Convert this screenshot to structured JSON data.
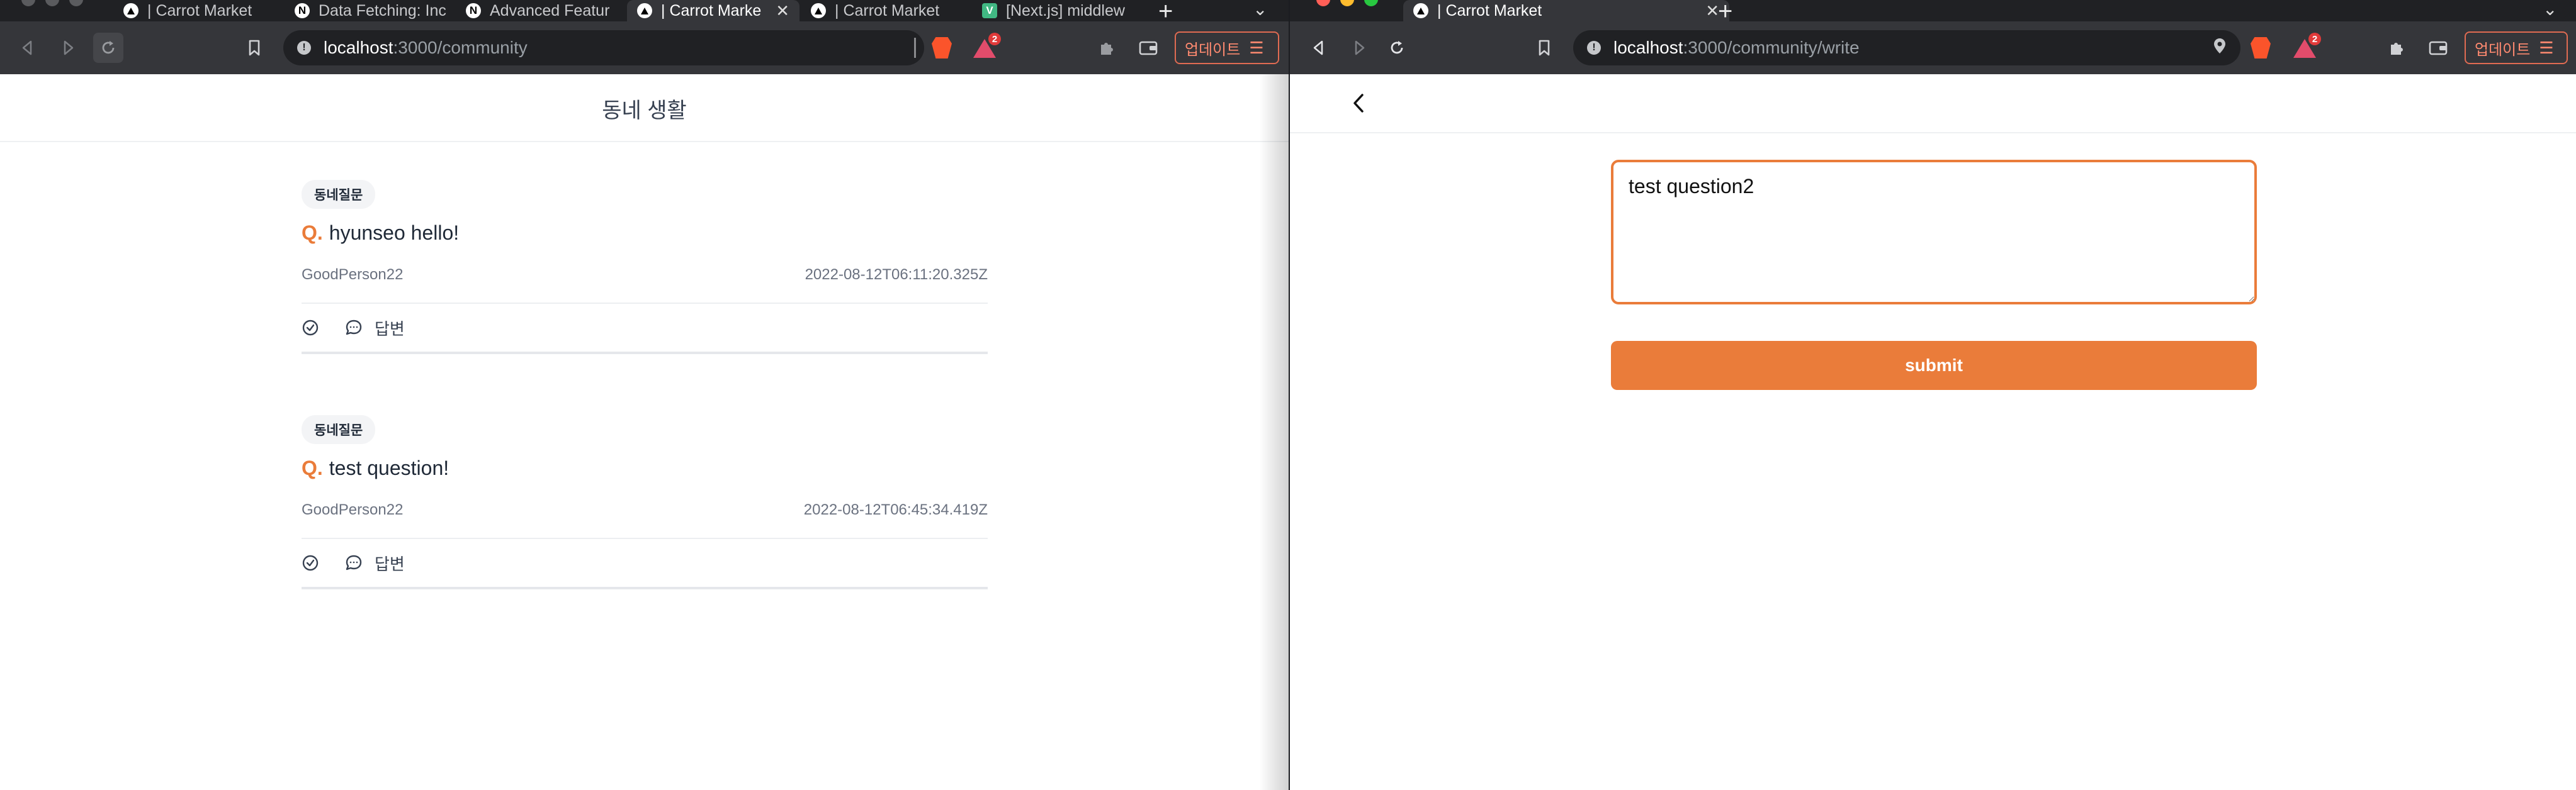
{
  "left_window": {
    "tabs": [
      {
        "label": "| Carrot Market",
        "icon": "carrot-favicon"
      },
      {
        "label": "Data Fetching: Inc",
        "icon": "nextjs-favicon"
      },
      {
        "label": "Advanced Featur",
        "icon": "nextjs-favicon"
      },
      {
        "label": "| Carrot Marke",
        "icon": "carrot-favicon",
        "active": true
      },
      {
        "label": "| Carrot Market",
        "icon": "carrot-favicon"
      },
      {
        "label": "[Next.js] middlew",
        "icon": "velog-favicon"
      }
    ],
    "url_host": "localhost",
    "url_path": ":3000/community",
    "update_label": "업데이트",
    "brave_badge": "2",
    "page_title": "동네 생활",
    "posts": [
      {
        "category": "동네질문",
        "q_mark": "Q.",
        "question": "hyunseo hello!",
        "author": "GoodPerson22",
        "date": "2022-08-12T06:11:20.325Z",
        "answer_label": "답변"
      },
      {
        "category": "동네질문",
        "q_mark": "Q.",
        "question": "test question!",
        "author": "GoodPerson22",
        "date": "2022-08-12T06:45:34.419Z",
        "answer_label": "답변"
      }
    ]
  },
  "right_window": {
    "tab_label": "| Carrot Market",
    "url_host": "localhost",
    "url_path": ":3000/community/write",
    "update_label": "업데이트",
    "brave_badge": "2",
    "question_value": "test question2",
    "submit_label": "submit"
  },
  "colors": {
    "accent": "#ea7c3a",
    "chrome_dark": "#202124",
    "chrome_toolbar": "#35363a"
  }
}
